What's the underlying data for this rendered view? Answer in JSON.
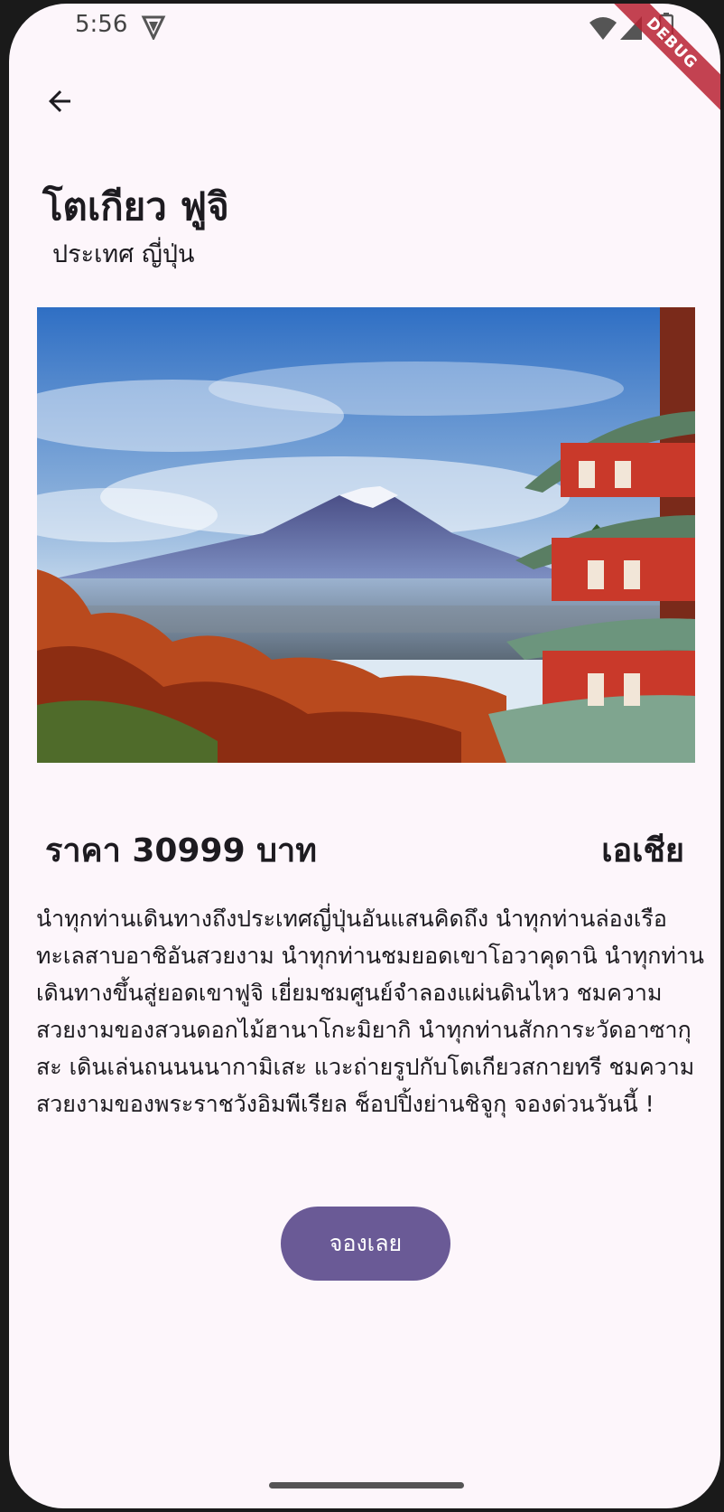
{
  "status_bar": {
    "time": "5:56",
    "debug_label": "DEBUG"
  },
  "header": {
    "title": "โตเกียว ฟูจิ",
    "subtitle": "ประเทศ ญี่ปุ่น"
  },
  "details": {
    "price": "ราคา 30999 บาท",
    "region": "เอเชีย",
    "description": "นำทุกท่านเดินทางถึงประเทศญี่ปุ่นอันแสนคิดถึง นำทุกท่านล่องเรือทะเลสาบอาชิอันสวยงาม นำทุกท่านชมยอดเขาโอวาคุดานิ นำทุกท่านเดินทางขึ้นสู่ยอดเขาฟูจิ เยี่ยมชมศูนย์จำลองแผ่นดินไหว ชมความสวยงามของสวนดอกไม้ฮานาโกะมิยากิ นำทุกท่านสักการะวัดอาซากุสะ เดินเล่นถนนนนากามิเสะ แวะถ่ายรูปกับโตเกียวสกายทรี ชมความสวยงามของพระราชวังอิมพีเรียล ช็อปปิ้งย่านชิจูกุ จองด่วนวันนี้ !"
  },
  "actions": {
    "book_label": "จองเลย"
  },
  "icons": {
    "back": "arrow-back-icon",
    "wifi": "wifi-icon",
    "signal": "signal-icon",
    "battery": "battery-icon",
    "app": "shield-app-icon"
  },
  "colors": {
    "background": "#fdf6fb",
    "button": "#6a5a96",
    "text": "#1d1b20",
    "debug_ribbon": "#b82233"
  }
}
